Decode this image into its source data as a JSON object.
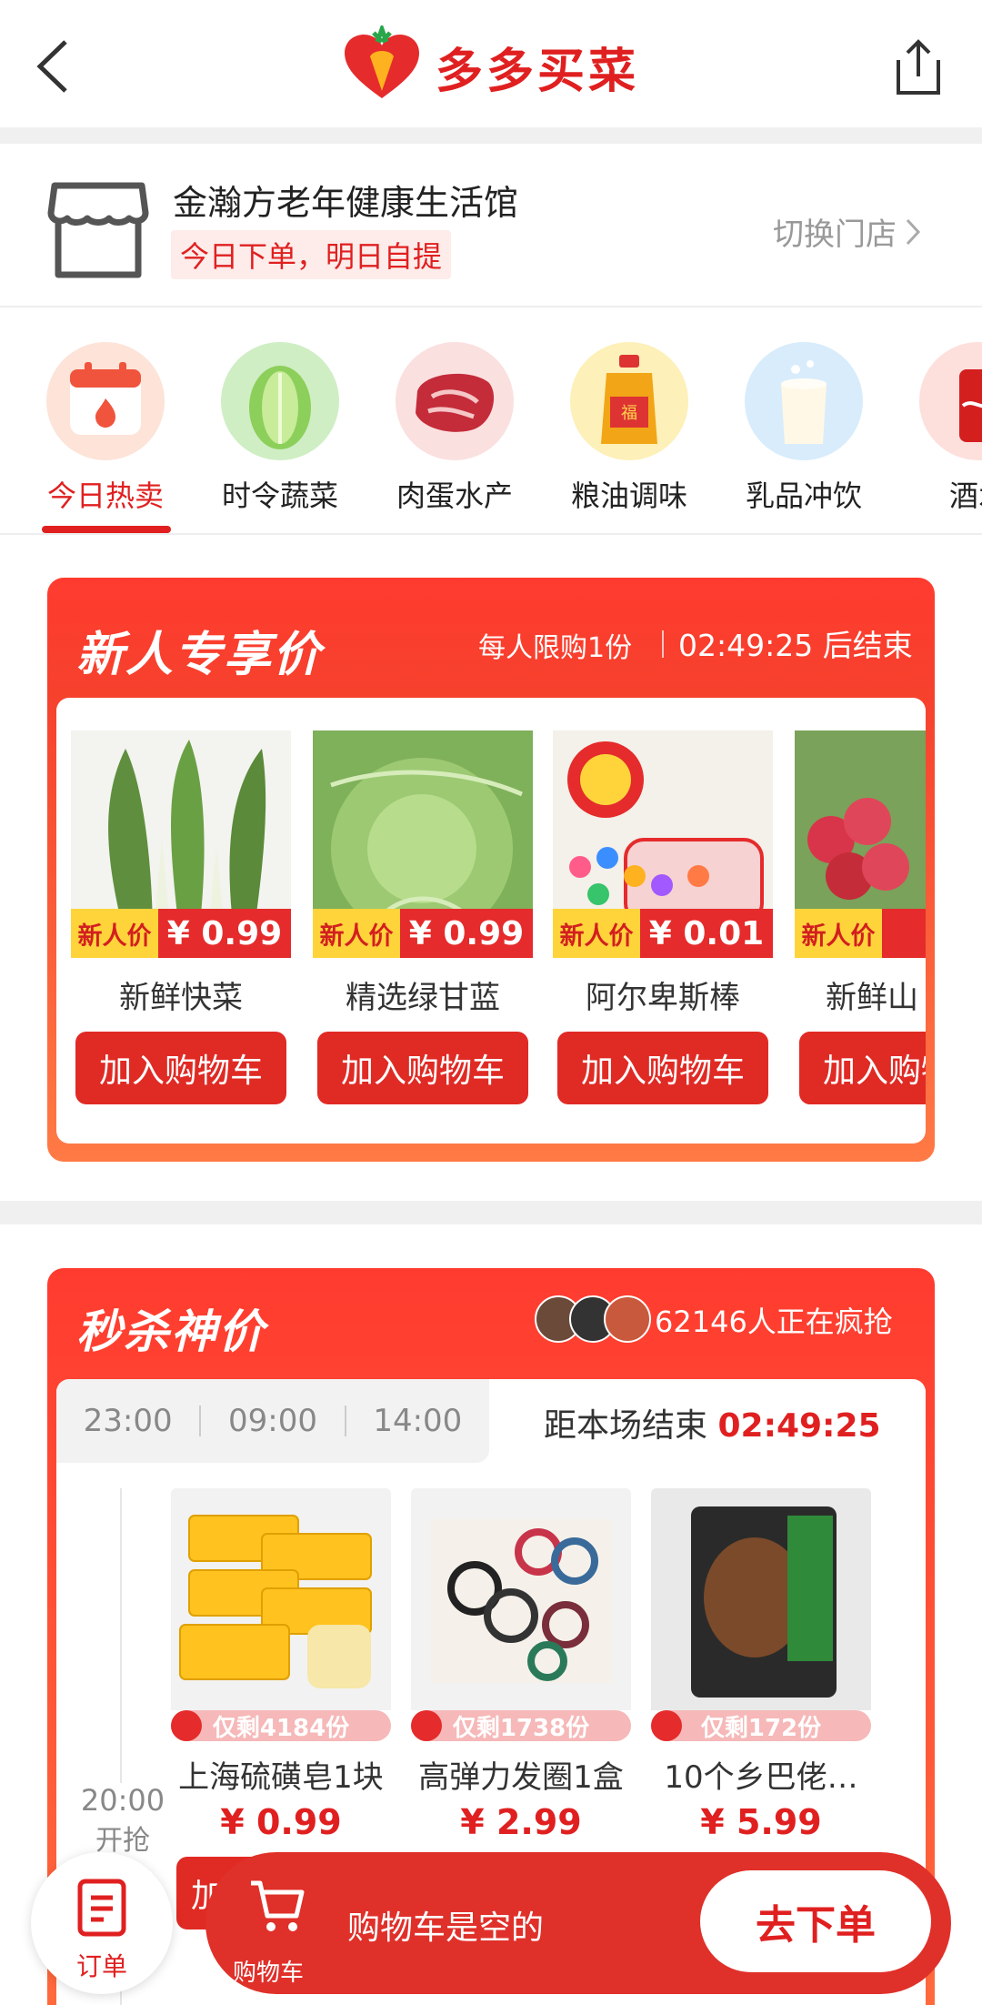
{
  "header": {
    "brand_title": "多多买菜"
  },
  "store": {
    "name": "金瀚方老年健康生活馆",
    "tag": "今日下单，明日自提",
    "switch_label": "切换门店"
  },
  "categories": [
    {
      "label": "今日热卖",
      "icon": "calendar-fire-icon"
    },
    {
      "label": "时令蔬菜",
      "icon": "cabbage-icon"
    },
    {
      "label": "肉蛋水产",
      "icon": "meat-icon"
    },
    {
      "label": "粮油调味",
      "icon": "oil-bottle-icon"
    },
    {
      "label": "乳品冲饮",
      "icon": "milk-icon"
    },
    {
      "label": "酒水",
      "icon": "cola-can-icon"
    }
  ],
  "newcomer": {
    "title": "新人专享价",
    "limit": "每人限购1份",
    "countdown": "02:49:25 后结束",
    "tag_label": "新人价",
    "add_to_cart": "加入购物车",
    "products": [
      {
        "name": "新鲜快菜",
        "price": "¥ 0.99"
      },
      {
        "name": "精选绿甘蓝",
        "price": "¥ 0.99"
      },
      {
        "name": "阿尔卑斯棒",
        "price": "¥ 0.01"
      },
      {
        "name": "新鲜山",
        "price": ""
      }
    ]
  },
  "flash_sale": {
    "title": "秒杀神价",
    "buyers": "62146人正在疯抢",
    "times": [
      "23:00",
      "09:00",
      "14:00"
    ],
    "end_label": "距本场结束",
    "end_countdown": "02:49:25",
    "start_time": "20:00",
    "start_label": "开抢",
    "button_label": "加入",
    "products": [
      {
        "stock": "仅剩4184份",
        "name": "上海硫磺皂1块",
        "price": "¥ 0.99"
      },
      {
        "stock": "仅剩1738份",
        "name": "高弹力发圈1盒",
        "price": "¥ 2.99"
      },
      {
        "stock": "仅剩172份",
        "name": "10个乡巴佬…",
        "price": "¥ 5.99"
      }
    ]
  },
  "bottom_bar": {
    "orders_label": "订单",
    "cart_label": "购物车",
    "cart_empty": "购物车是空的",
    "checkout_label": "去下单"
  },
  "colors": {
    "accent": "#e02020",
    "banner": "#f6412d"
  }
}
